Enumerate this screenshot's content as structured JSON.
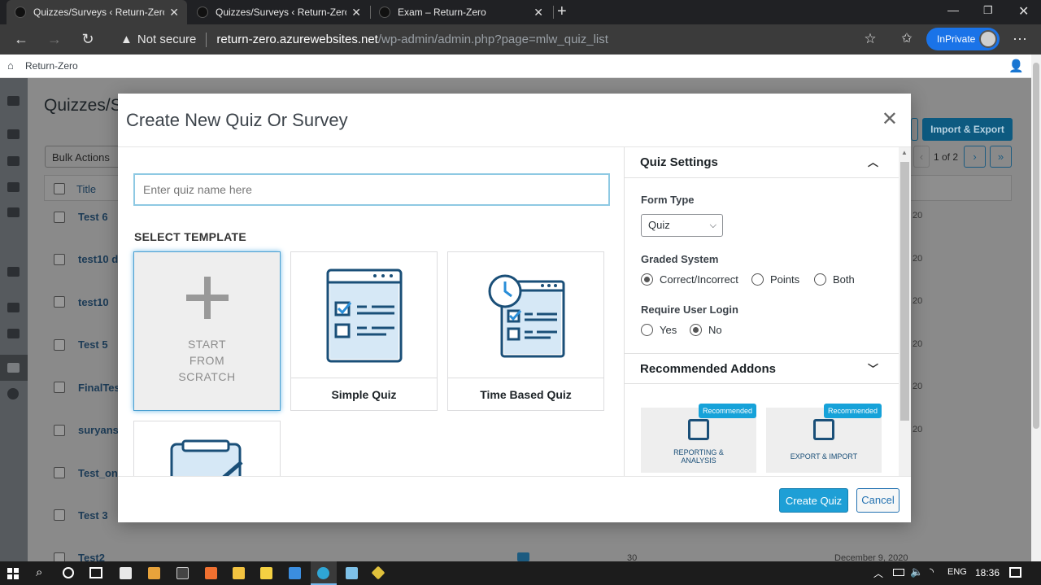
{
  "browser": {
    "tabs": [
      {
        "label": "Quizzes/Surveys ‹ Return-Zero –"
      },
      {
        "label": "Quizzes/Surveys ‹ Return-Zero –"
      },
      {
        "label": "Exam – Return-Zero"
      }
    ],
    "security_label": "Not secure",
    "url_domain": "return-zero.azurewebsites.net",
    "url_path": "/wp-admin/admin.php?page=mlw_quiz_list",
    "profile_label": "InPrivate"
  },
  "wp": {
    "site_name": "Return-Zero",
    "page_title": "Quizzes/S",
    "bulk_actions": "Bulk Actions",
    "import_export": "Import & Export",
    "pagination": "1 of 2",
    "column_title": "Title",
    "rows": [
      "Test 6",
      "test10 du",
      "test10",
      "Test 5",
      "FinalTest",
      "suryansh",
      "Test_on",
      "Test 3",
      "Test2"
    ],
    "last_row_count": "30",
    "last_row_date": "December 9, 2020",
    "date_fragment": "20"
  },
  "modal": {
    "title": "Create New Quiz Or Survey",
    "quiz_name_placeholder": "Enter quiz name here",
    "select_template": "SELECT TEMPLATE",
    "scratch_line1": "START",
    "scratch_line2": "FROM",
    "scratch_line3": "SCRATCH",
    "templates": [
      {
        "label": "Simple Quiz"
      },
      {
        "label": "Time Based Quiz"
      }
    ],
    "settings": {
      "title": "Quiz Settings",
      "form_type_label": "Form Type",
      "form_type_value": "Quiz",
      "graded_label": "Graded System",
      "graded_options": [
        "Correct/Incorrect",
        "Points",
        "Both"
      ],
      "login_label": "Require User Login",
      "login_options": [
        "Yes",
        "No"
      ],
      "addons_title": "Recommended Addons",
      "addons": [
        {
          "badge": "Recommended",
          "name1": "REPORTING &",
          "name2": "ANALYSIS"
        },
        {
          "badge": "Recommended",
          "name1": "EXPORT & IMPORT",
          "name2": ""
        }
      ]
    },
    "create_button": "Create Quiz",
    "cancel_button": "Cancel"
  },
  "taskbar": {
    "language": "ENG",
    "time": "18:36"
  }
}
